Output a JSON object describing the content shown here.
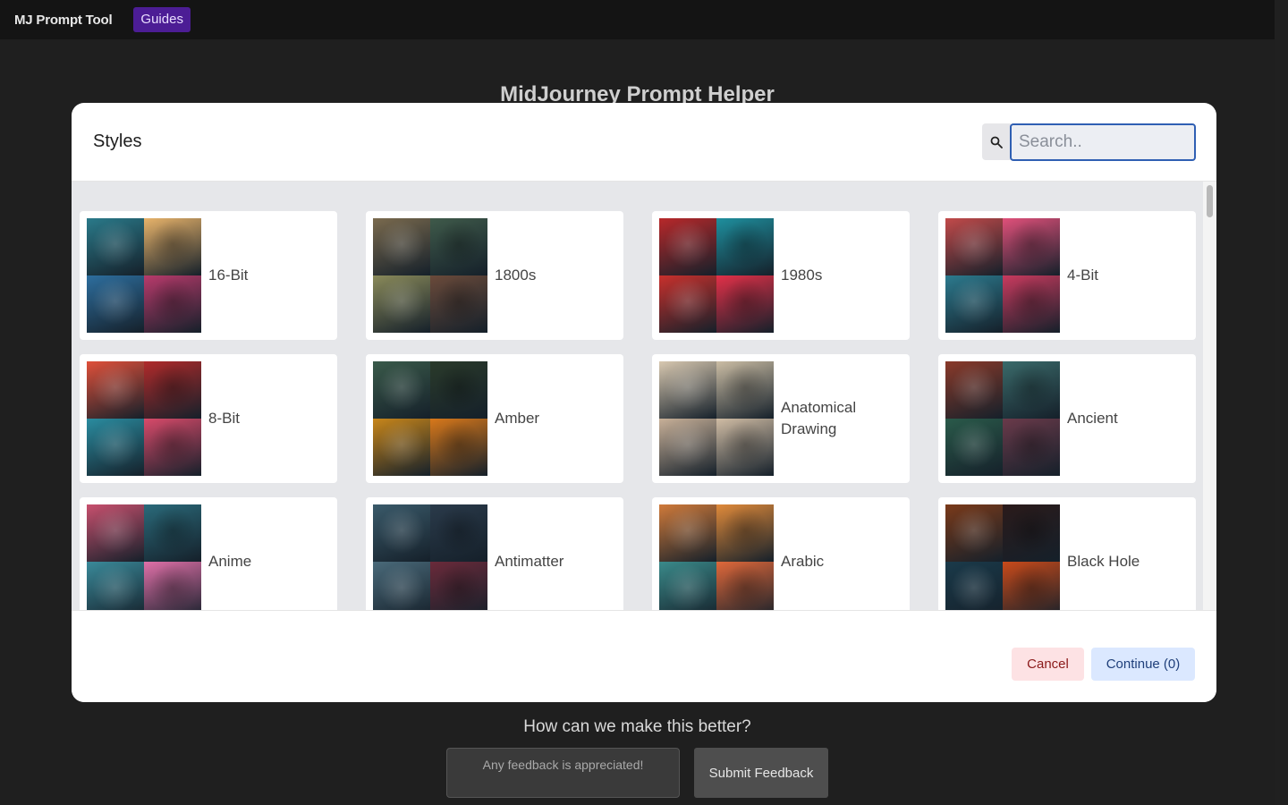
{
  "nav": {
    "brand": "MJ Prompt Tool",
    "guides": "Guides"
  },
  "page": {
    "title": "MidJourney Prompt Helper"
  },
  "modal": {
    "title": "Styles",
    "search_icon": "search-icon",
    "search_placeholder": "Search..",
    "cancel_label": "Cancel",
    "continue_label": "Continue (0)",
    "styles": [
      {
        "label": "16-Bit",
        "colors": [
          "#2a7a8a",
          "#e8b36a",
          "#2d6e9e",
          "#b83a6b"
        ]
      },
      {
        "label": "1800s",
        "colors": [
          "#7a6a4e",
          "#3f5a4a",
          "#8a8a5a",
          "#6a4a3a"
        ]
      },
      {
        "label": "1980s",
        "colors": [
          "#b8282a",
          "#1e8f9e",
          "#c8302c",
          "#e23048"
        ]
      },
      {
        "label": "4-Bit",
        "colors": [
          "#c24a4a",
          "#e0507a",
          "#2c7a8e",
          "#c83a5e"
        ]
      },
      {
        "label": "8-Bit",
        "colors": [
          "#e0503a",
          "#b02a2a",
          "#2a8ca0",
          "#d84a6a"
        ]
      },
      {
        "label": "Amber",
        "colors": [
          "#3a5a4a",
          "#2a3a2a",
          "#c8861a",
          "#d8781a"
        ]
      },
      {
        "label": "Anatomical Drawing",
        "colors": [
          "#d8c8b0",
          "#cbbda4",
          "#c8b098",
          "#d0bca4"
        ]
      },
      {
        "label": "Ancient",
        "colors": [
          "#8a3a2a",
          "#3a6a6a",
          "#2a5a4a",
          "#6a3a4a"
        ]
      },
      {
        "label": "Anime",
        "colors": [
          "#c8506e",
          "#2a6a7a",
          "#3a8a9a",
          "#e070a8"
        ]
      },
      {
        "label": "Antimatter",
        "colors": [
          "#3a5a6a",
          "#2a3a4a",
          "#4a6a7a",
          "#6a2a3a"
        ]
      },
      {
        "label": "Arabic",
        "colors": [
          "#d07a3a",
          "#e08a3a",
          "#3a8a8a",
          "#e0683a"
        ]
      },
      {
        "label": "Black Hole",
        "colors": [
          "#7a3a1a",
          "#2a1a1a",
          "#1a3a4a",
          "#c84a1a"
        ]
      }
    ]
  },
  "feedback": {
    "heading": "How can we make this better?",
    "placeholder": "Any feedback is appreciated!",
    "submit_label": "Submit Feedback"
  }
}
